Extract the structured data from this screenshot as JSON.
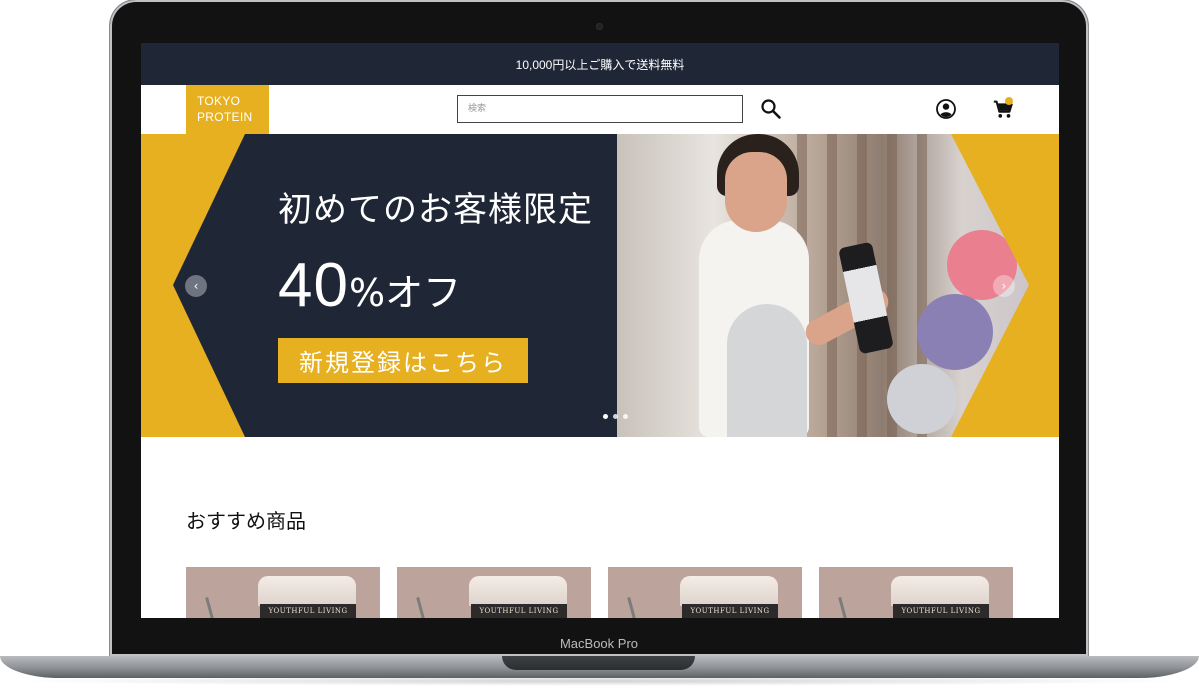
{
  "device": {
    "label": "MacBook Pro"
  },
  "announcement": {
    "text": "10,000円以上ご購入で送料無料"
  },
  "header": {
    "logo_line1": "TOKYO",
    "logo_line2": "PROTEIN",
    "search_placeholder": "検索",
    "icons": [
      "search-icon",
      "account-icon",
      "cart-icon"
    ]
  },
  "hero": {
    "title": "初めてのお客様限定",
    "discount_number": "40",
    "discount_suffix": "%オフ",
    "cta_label": "新規登録はこちら",
    "prev_label": "‹",
    "next_label": "›",
    "slides": 3
  },
  "recommended": {
    "title": "おすすめ商品",
    "products": [
      {
        "brand": "YOUTHFUL LIVING"
      },
      {
        "brand": "YOUTHFUL LIVING"
      },
      {
        "brand": "YOUTHFUL LIVING"
      },
      {
        "brand": "YOUTHFUL LIVING"
      }
    ]
  },
  "colors": {
    "accent": "#e6b020",
    "dark": "#1f2737"
  }
}
